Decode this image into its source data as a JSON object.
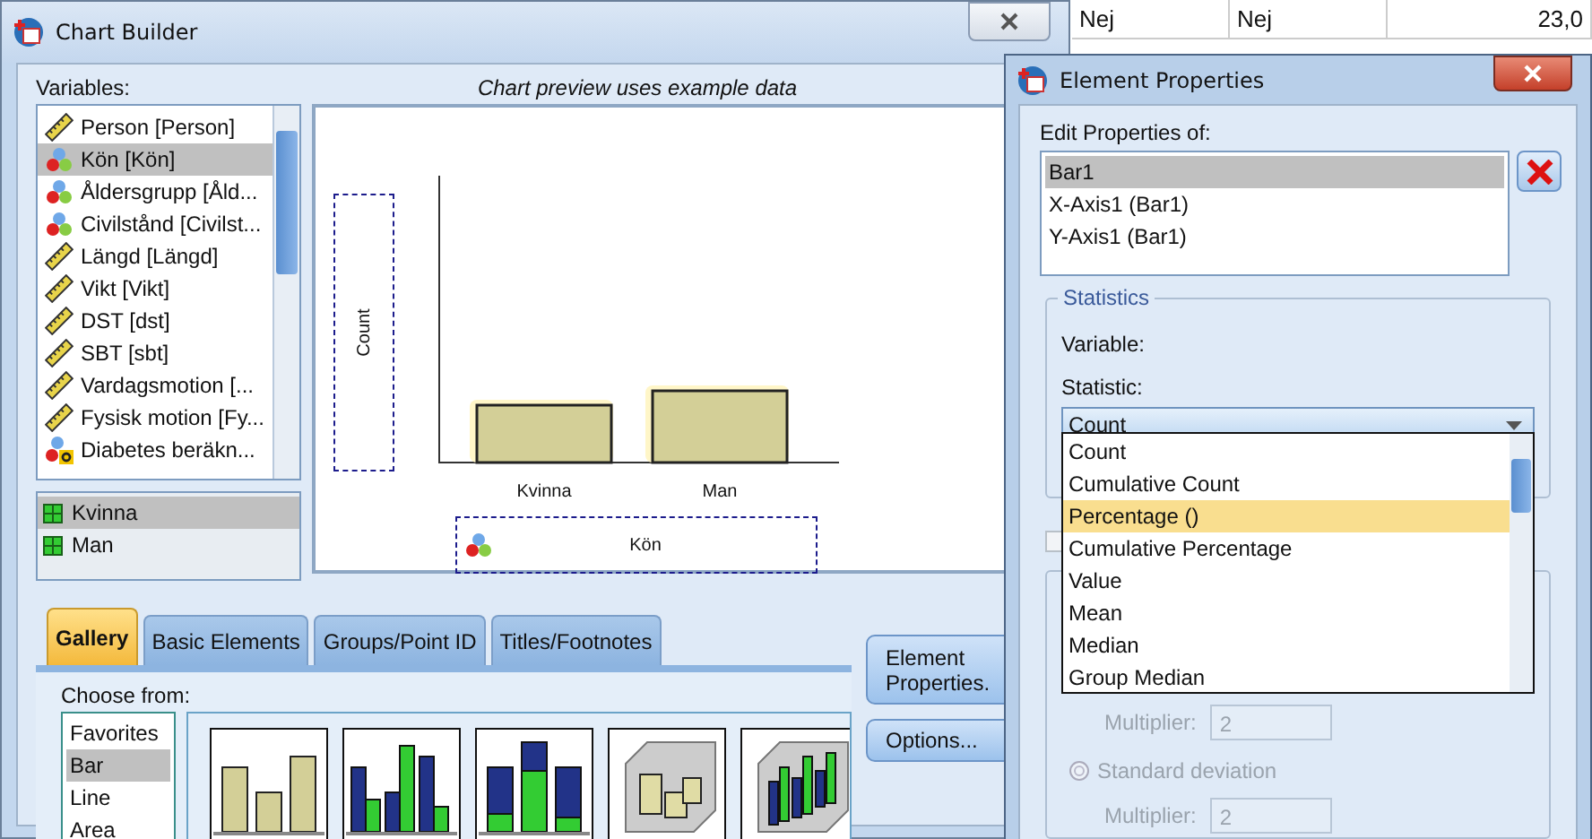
{
  "background_table": {
    "rows": [
      [
        "Nej",
        "Nej",
        "23,0"
      ]
    ]
  },
  "chart_builder": {
    "title": "Chart Builder",
    "variables_label": "Variables:",
    "preview_note": "Chart preview uses example data",
    "variables": [
      {
        "label": "Person [Person]",
        "kind": "scale",
        "selected": false
      },
      {
        "label": "Kön [Kön]",
        "kind": "nominal",
        "selected": true
      },
      {
        "label": "Åldersgrupp [Åld...",
        "kind": "nominal",
        "selected": false
      },
      {
        "label": "Civilstånd [Civilst...",
        "kind": "nominal",
        "selected": false
      },
      {
        "label": "Längd [Längd]",
        "kind": "scale",
        "selected": false
      },
      {
        "label": "Vikt [Vikt]",
        "kind": "scale",
        "selected": false
      },
      {
        "label": "DST [dst]",
        "kind": "scale",
        "selected": false
      },
      {
        "label": "SBT [sbt]",
        "kind": "scale",
        "selected": false
      },
      {
        "label": "Vardagsmotion [...",
        "kind": "scale",
        "selected": false
      },
      {
        "label": "Fysisk motion [Fy...",
        "kind": "scale",
        "selected": false
      },
      {
        "label": "Diabetes beräkn...",
        "kind": "string",
        "selected": false
      }
    ],
    "categories": [
      {
        "label": "Kvinna",
        "selected": true
      },
      {
        "label": "Man",
        "selected": false
      }
    ],
    "preview": {
      "y_axis_title": "Count",
      "x_axis_title": "Kön",
      "bars": [
        {
          "label": "Kvinna"
        },
        {
          "label": "Man"
        }
      ]
    },
    "tabs": [
      {
        "label": "Gallery",
        "selected": true
      },
      {
        "label": "Basic Elements",
        "selected": false
      },
      {
        "label": "Groups/Point ID",
        "selected": false
      },
      {
        "label": "Titles/Footnotes",
        "selected": false
      }
    ],
    "choose_from_label": "Choose from:",
    "chart_types": [
      {
        "label": "Favorites",
        "selected": false
      },
      {
        "label": "Bar",
        "selected": true
      },
      {
        "label": "Line",
        "selected": false
      },
      {
        "label": "Area",
        "selected": false
      }
    ],
    "gallery": [
      {
        "kind": "simple"
      },
      {
        "kind": "clustered"
      },
      {
        "kind": "stacked"
      },
      {
        "kind": "simple-3d"
      },
      {
        "kind": "clustered-3d"
      }
    ],
    "buttons": [
      "Element Properties.",
      "Options..."
    ]
  },
  "element_properties": {
    "title": "Element Properties",
    "edit_label": "Edit Properties of:",
    "elements": [
      {
        "label": "Bar1",
        "selected": true
      },
      {
        "label": "X-Axis1 (Bar1)",
        "selected": false
      },
      {
        "label": "Y-Axis1 (Bar1)",
        "selected": false
      }
    ],
    "statistics_legend": "Statistics",
    "variable_label": "Variable:",
    "statistic_label": "Statistic:",
    "statistic_value": "Count",
    "statistic_options": [
      {
        "label": "Count",
        "selected": false
      },
      {
        "label": "Cumulative Count",
        "selected": false
      },
      {
        "label": "Percentage ()",
        "selected": true
      },
      {
        "label": "Cumulative Percentage",
        "selected": false
      },
      {
        "label": "Value",
        "selected": false
      },
      {
        "label": "Mean",
        "selected": false
      },
      {
        "label": "Median",
        "selected": false
      },
      {
        "label": "Group Median",
        "selected": false
      }
    ],
    "std_checkbox": {
      "checked": false,
      "disabled": true
    },
    "multiplier_1": {
      "label": "Multiplier:",
      "value": "2",
      "disabled": true
    },
    "std_deviation": {
      "label": "Standard deviation",
      "checked": false,
      "disabled": true
    },
    "multiplier_2": {
      "label": "Multiplier:",
      "value": "2",
      "disabled": true
    }
  }
}
